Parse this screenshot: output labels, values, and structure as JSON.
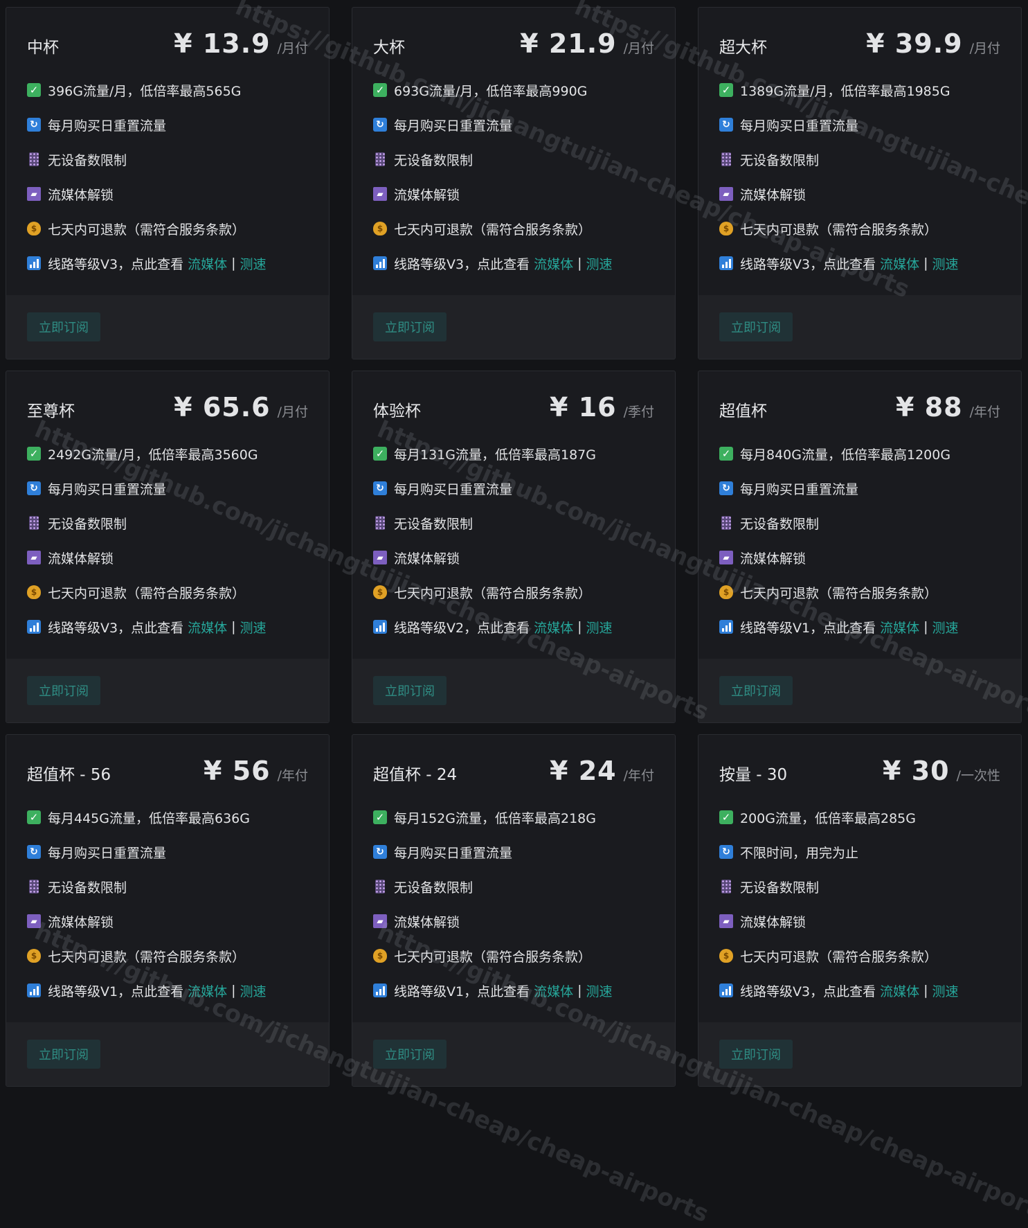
{
  "links": {
    "media": "流媒体",
    "separator": "|",
    "speed": "测速"
  },
  "button_label": "立即订阅",
  "watermark": "https://github.com/jichangtuijian-cheap/cheap-airports",
  "colors": {
    "background": "#131417",
    "card": "#1a1b1f",
    "footer": "#212226",
    "accent": "#26a69a"
  },
  "plans": [
    {
      "name": "中杯",
      "price": "¥ 13.9",
      "period": "/月付",
      "features": [
        "396G流量/月，低倍率最高565G",
        "每月购买日重置流量",
        "无设备数限制",
        "流媒体解锁",
        "七天内可退款（需符合服务条款）",
        "线路等级V3，点此查看"
      ]
    },
    {
      "name": "大杯",
      "price": "¥ 21.9",
      "period": "/月付",
      "features": [
        "693G流量/月，低倍率最高990G",
        "每月购买日重置流量",
        "无设备数限制",
        "流媒体解锁",
        "七天内可退款（需符合服务条款）",
        "线路等级V3，点此查看"
      ]
    },
    {
      "name": "超大杯",
      "price": "¥ 39.9",
      "period": "/月付",
      "features": [
        "1389G流量/月，低倍率最高1985G",
        "每月购买日重置流量",
        "无设备数限制",
        "流媒体解锁",
        "七天内可退款（需符合服务条款）",
        "线路等级V3，点此查看"
      ]
    },
    {
      "name": "至尊杯",
      "price": "¥ 65.6",
      "period": "/月付",
      "features": [
        "2492G流量/月，低倍率最高3560G",
        "每月购买日重置流量",
        "无设备数限制",
        "流媒体解锁",
        "七天内可退款（需符合服务条款）",
        "线路等级V3，点此查看"
      ]
    },
    {
      "name": "体验杯",
      "price": "¥ 16",
      "period": "/季付",
      "features": [
        "每月131G流量，低倍率最高187G",
        "每月购买日重置流量",
        "无设备数限制",
        "流媒体解锁",
        "七天内可退款（需符合服务条款）",
        "线路等级V2，点此查看"
      ]
    },
    {
      "name": "超值杯",
      "price": "¥ 88",
      "period": "/年付",
      "features": [
        "每月840G流量，低倍率最高1200G",
        "每月购买日重置流量",
        "无设备数限制",
        "流媒体解锁",
        "七天内可退款（需符合服务条款）",
        "线路等级V1，点此查看"
      ]
    },
    {
      "name": "超值杯 - 56",
      "price": "¥ 56",
      "period": "/年付",
      "features": [
        "每月445G流量，低倍率最高636G",
        "每月购买日重置流量",
        "无设备数限制",
        "流媒体解锁",
        "七天内可退款（需符合服务条款）",
        "线路等级V1，点此查看"
      ]
    },
    {
      "name": "超值杯 - 24",
      "price": "¥ 24",
      "period": "/年付",
      "features": [
        "每月152G流量，低倍率最高218G",
        "每月购买日重置流量",
        "无设备数限制",
        "流媒体解锁",
        "七天内可退款（需符合服务条款）",
        "线路等级V1，点此查看"
      ]
    },
    {
      "name": "按量 - 30",
      "price": "¥ 30",
      "period": "/一次性",
      "features": [
        "200G流量，低倍率最高285G",
        "不限时间，用完为止",
        "无设备数限制",
        "流媒体解锁",
        "七天内可退款（需符合服务条款）",
        "线路等级V3，点此查看"
      ]
    }
  ],
  "feature_icons": [
    "check-icon",
    "reset-icon",
    "device-icon",
    "film-icon",
    "money-bag-icon",
    "bar-chart-icon"
  ]
}
